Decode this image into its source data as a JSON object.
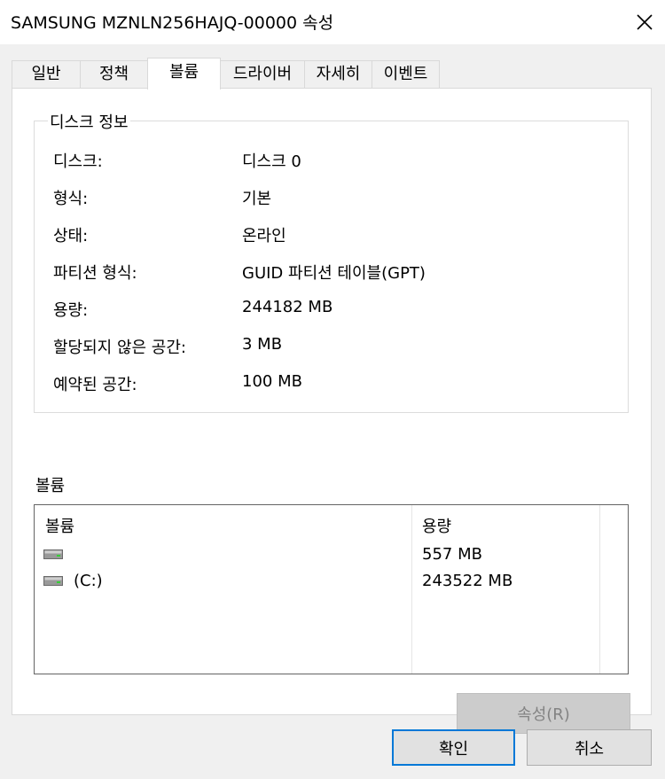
{
  "window": {
    "title": "SAMSUNG MZNLN256HAJQ-00000 속성"
  },
  "tabs": [
    {
      "label": "일반"
    },
    {
      "label": "정책"
    },
    {
      "label": "볼륨"
    },
    {
      "label": "드라이버"
    },
    {
      "label": "자세히"
    },
    {
      "label": "이벤트"
    }
  ],
  "disk_info": {
    "group_label": "디스크 정보",
    "rows": [
      {
        "label": "디스크:",
        "value": "디스크 0"
      },
      {
        "label": "형식:",
        "value": "기본"
      },
      {
        "label": "상태:",
        "value": "온라인"
      },
      {
        "label": "파티션 형식:",
        "value": "GUID 파티션 테이블(GPT)"
      },
      {
        "label": "용량:",
        "value": "244182 MB"
      },
      {
        "label": "할당되지 않은 공간:",
        "value": "3 MB"
      },
      {
        "label": "예약된 공간:",
        "value": "100 MB"
      }
    ]
  },
  "volumes": {
    "section_label": "볼륨",
    "columns": [
      "볼륨",
      "용량"
    ],
    "rows": [
      {
        "name": "",
        "capacity": "557 MB"
      },
      {
        "name": "(C:)",
        "capacity": "243522 MB"
      }
    ],
    "icon": "drive-icon"
  },
  "buttons": {
    "properties": "속성(R)",
    "ok": "확인",
    "cancel": "취소"
  }
}
